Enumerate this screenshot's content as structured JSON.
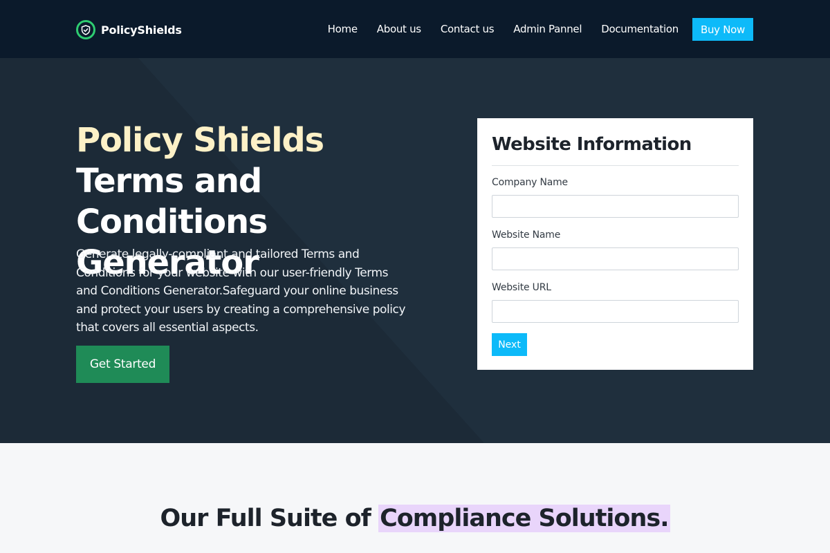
{
  "nav": {
    "brand": "PolicyShields",
    "links": [
      "Home",
      "About us",
      "Contact us",
      "Admin Pannel",
      "Documentation"
    ],
    "buy_label": "Buy Now"
  },
  "hero": {
    "title_accent": "Policy Shields",
    "title_rest": " Terms and Conditions Generator",
    "description": "Generate legally-compliant and tailored Terms and Conditions for your website with our user-friendly Terms and Conditions Generator.Safeguard your online business and protect your users by creating a comprehensive policy that covers all essential aspects.",
    "cta_label": "Get Started"
  },
  "form": {
    "title": "Website Information",
    "fields": [
      {
        "label": "Company Name",
        "value": ""
      },
      {
        "label": "Website Name",
        "value": ""
      },
      {
        "label": "Website URL",
        "value": ""
      }
    ],
    "next_label": "Next"
  },
  "suite": {
    "title_plain": "Our Full Suite of ",
    "title_highlight": "Compliance Solutions."
  },
  "colors": {
    "nav_bg": "#0b1a2b",
    "hero_bg": "#1f2f3d",
    "accent_blue": "#0dbaf9",
    "cta_green": "#1f8b57",
    "title_accent": "#fdf1c7",
    "highlight": "#e9d5fb"
  },
  "icons": {
    "brand": "shield-check-icon"
  }
}
